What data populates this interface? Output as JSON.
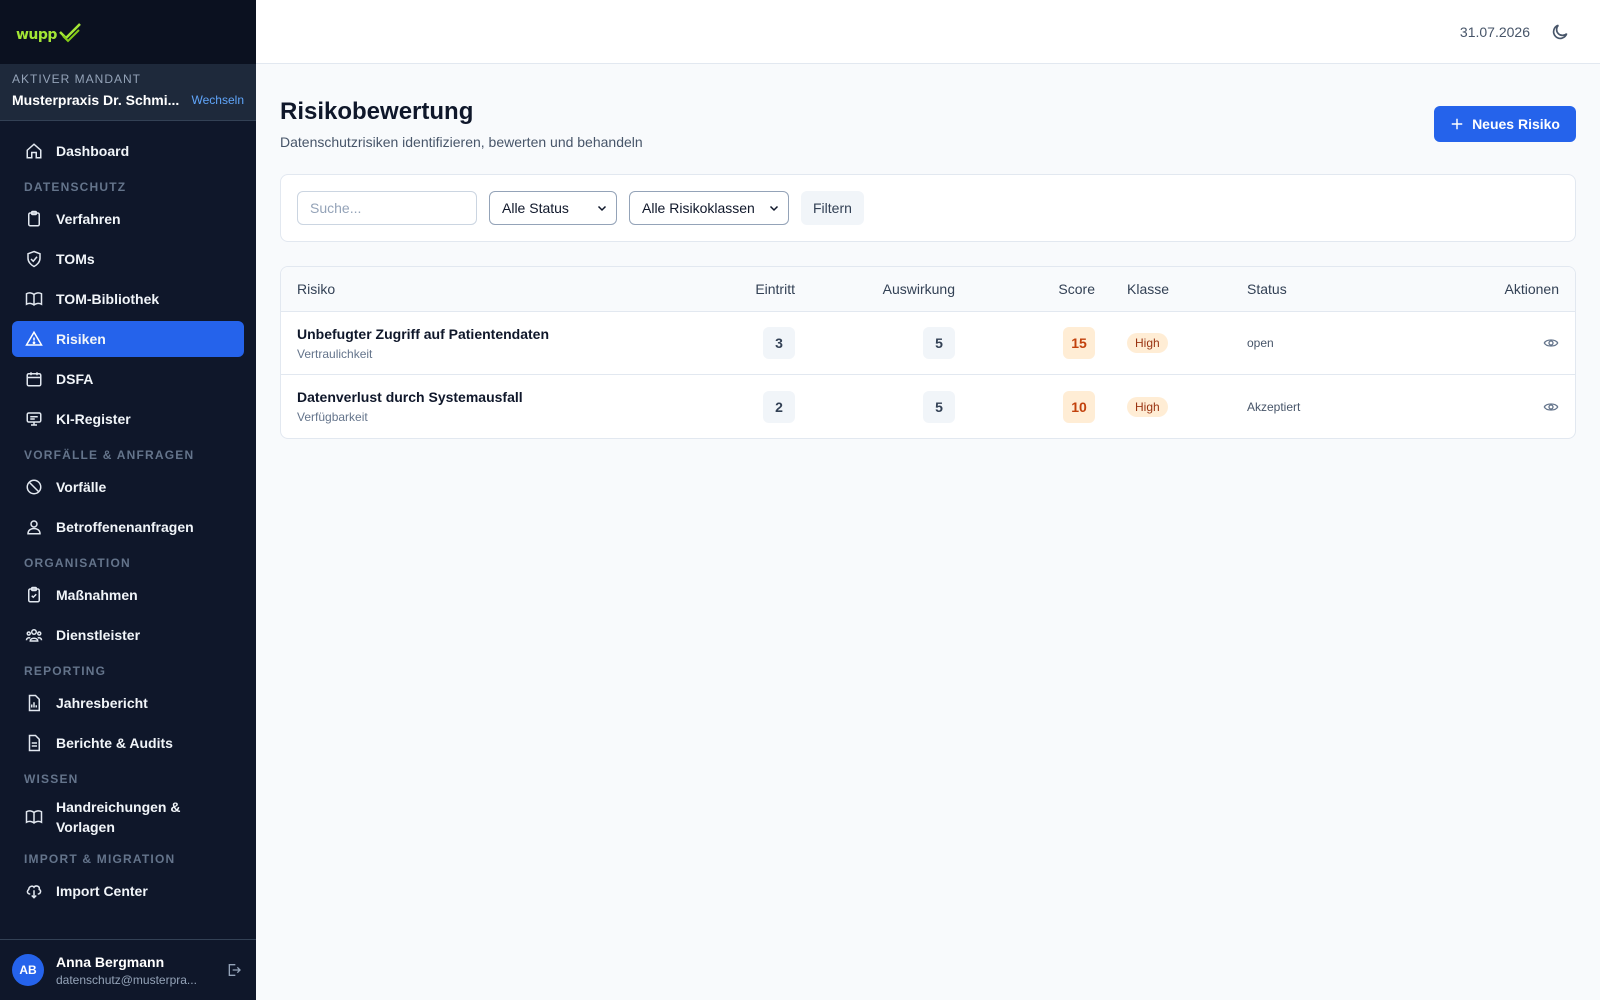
{
  "brand": {
    "logo_text": "wupp",
    "accent": "#a3e635"
  },
  "mandant": {
    "label": "Aktiver Mandant",
    "name": "Musterpraxis Dr. Schmi...",
    "switch_label": "Wechseln"
  },
  "nav": {
    "dashboard": "Dashboard",
    "section_datenschutz": "Datenschutz",
    "verfahren": "Verfahren",
    "toms": "TOMs",
    "tom_bibliothek": "TOM-Bibliothek",
    "risiken": "Risiken",
    "dsfa": "DSFA",
    "ki_register": "KI-Register",
    "section_vorfaelle": "Vorfälle & Anfragen",
    "vorfaelle": "Vorfälle",
    "betroffenenanfragen": "Betroffenenanfragen",
    "section_organisation": "Organisation",
    "massnahmen": "Maßnahmen",
    "dienstleister": "Dienstleister",
    "section_reporting": "Reporting",
    "jahresbericht": "Jahresbericht",
    "berichte": "Berichte & Audits",
    "section_wissen": "Wissen",
    "handreichungen_line1": "Handreichungen &",
    "handreichungen_line2": "Vorlagen",
    "section_import": "Import & Migration",
    "import_center": "Import Center"
  },
  "user": {
    "initials": "AB",
    "name": "Anna Bergmann",
    "email": "datenschutz@musterpra..."
  },
  "header": {
    "date": "31.07.2026"
  },
  "page": {
    "title": "Risikobewertung",
    "subtitle": "Datenschutzrisiken identifizieren, bewerten und behandeln",
    "new_button": "Neues Risiko"
  },
  "filters": {
    "search_placeholder": "Suche...",
    "status_selected": "Alle Status",
    "class_selected": "Alle Risikoklassen",
    "filter_button": "Filtern"
  },
  "table": {
    "headers": {
      "risk": "Risiko",
      "occurrence": "Eintritt",
      "impact": "Auswirkung",
      "score": "Score",
      "class": "Klasse",
      "status": "Status",
      "actions": "Aktionen"
    },
    "rows": [
      {
        "title": "Unbefugter Zugriff auf Patientendaten",
        "category": "Vertraulichkeit",
        "occurrence": "3",
        "impact": "5",
        "score": "15",
        "class": "High",
        "status": "open"
      },
      {
        "title": "Datenverlust durch Systemausfall",
        "category": "Verfügbarkeit",
        "occurrence": "2",
        "impact": "5",
        "score": "10",
        "class": "High",
        "status": "Akzeptiert"
      }
    ]
  },
  "colors": {
    "primary": "#2563eb",
    "sidebar": "#0f172a",
    "score_bg": "#ffedd5",
    "score_text": "#c2410c"
  }
}
